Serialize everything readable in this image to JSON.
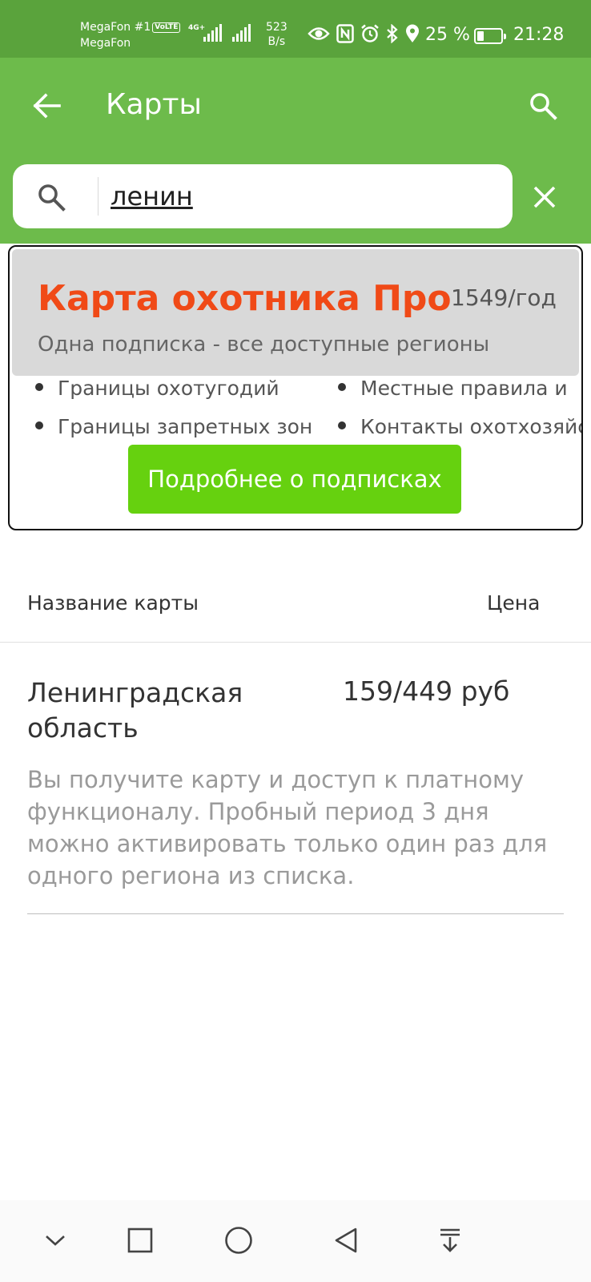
{
  "status_bar": {
    "carrier_1": "MegaFon #1",
    "volte": "VoLTE",
    "carrier_2": "MegaFon",
    "network": "4G+",
    "speed_value": "523",
    "speed_unit": "B/s",
    "battery_percent": "25 %",
    "time": "21:28",
    "icons": [
      "eye-icon",
      "nfc-icon",
      "alarm-icon",
      "bluetooth-icon",
      "location-icon"
    ]
  },
  "app_bar": {
    "title": "Карты",
    "back_icon": "arrow-left-icon",
    "search_icon": "search-icon"
  },
  "search": {
    "value": "ленин",
    "clear_icon": "close-icon"
  },
  "promo": {
    "title": "Карта охотника Про",
    "price": "1549/год",
    "subtitle": "Одна подписка - все доступные регионы",
    "features": [
      "Границы охотугодий",
      "Границы запретных зон",
      "Местные правила и",
      "Контакты охотхозяйс"
    ],
    "button_label": "Подробнее о подписках",
    "title_color": "#f04a17",
    "button_color": "#66d10f"
  },
  "table": {
    "col_name": "Название карты",
    "col_price": "Цена",
    "items": [
      {
        "name": "Ленинградская область",
        "price": "159/449 руб",
        "description": "Вы получите карту и доступ к платному функционалу. Пробный период 3 дня можно активировать только один раз для одного региона из списка."
      }
    ]
  },
  "colors": {
    "status_bar": "#5aa33c",
    "app_bar": "#6dbb4b"
  },
  "nav_bar": {
    "buttons": [
      "chevron-down-icon",
      "recents-icon",
      "home-icon",
      "back-triangle-icon",
      "notification-pull-icon"
    ]
  }
}
